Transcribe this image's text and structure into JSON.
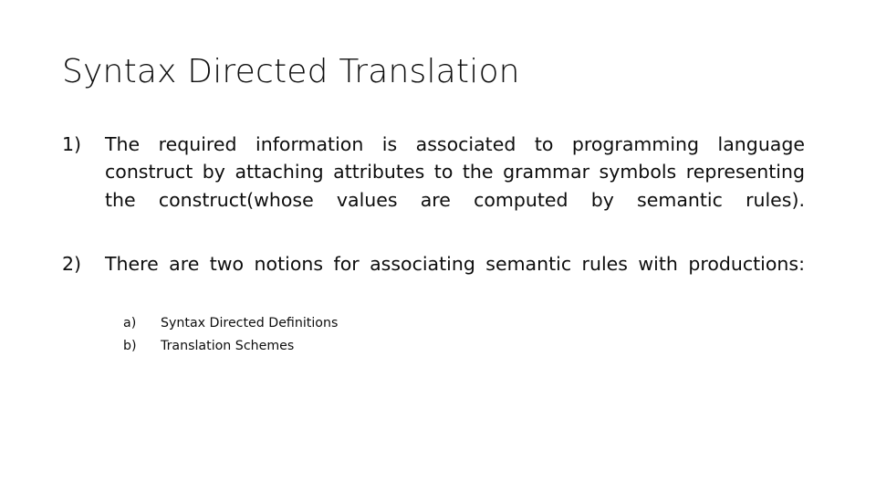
{
  "slide": {
    "title": "Syntax Directed Translation",
    "background_color": "#ffffff",
    "text_color": "#0d0d0d",
    "numbered_items": [
      {
        "marker": "1)",
        "text": "The required information is associated to programming language construct by attaching attributes to the grammar symbols representing the construct(whose values are computed by semantic rules)."
      },
      {
        "marker": "2)",
        "text": "There are two notions for associating semantic rules with productions:"
      }
    ],
    "sub_items": [
      {
        "marker": "a)",
        "text": "Syntax Directed Definitions"
      },
      {
        "marker": "b)",
        "text": "Translation Schemes"
      }
    ]
  }
}
